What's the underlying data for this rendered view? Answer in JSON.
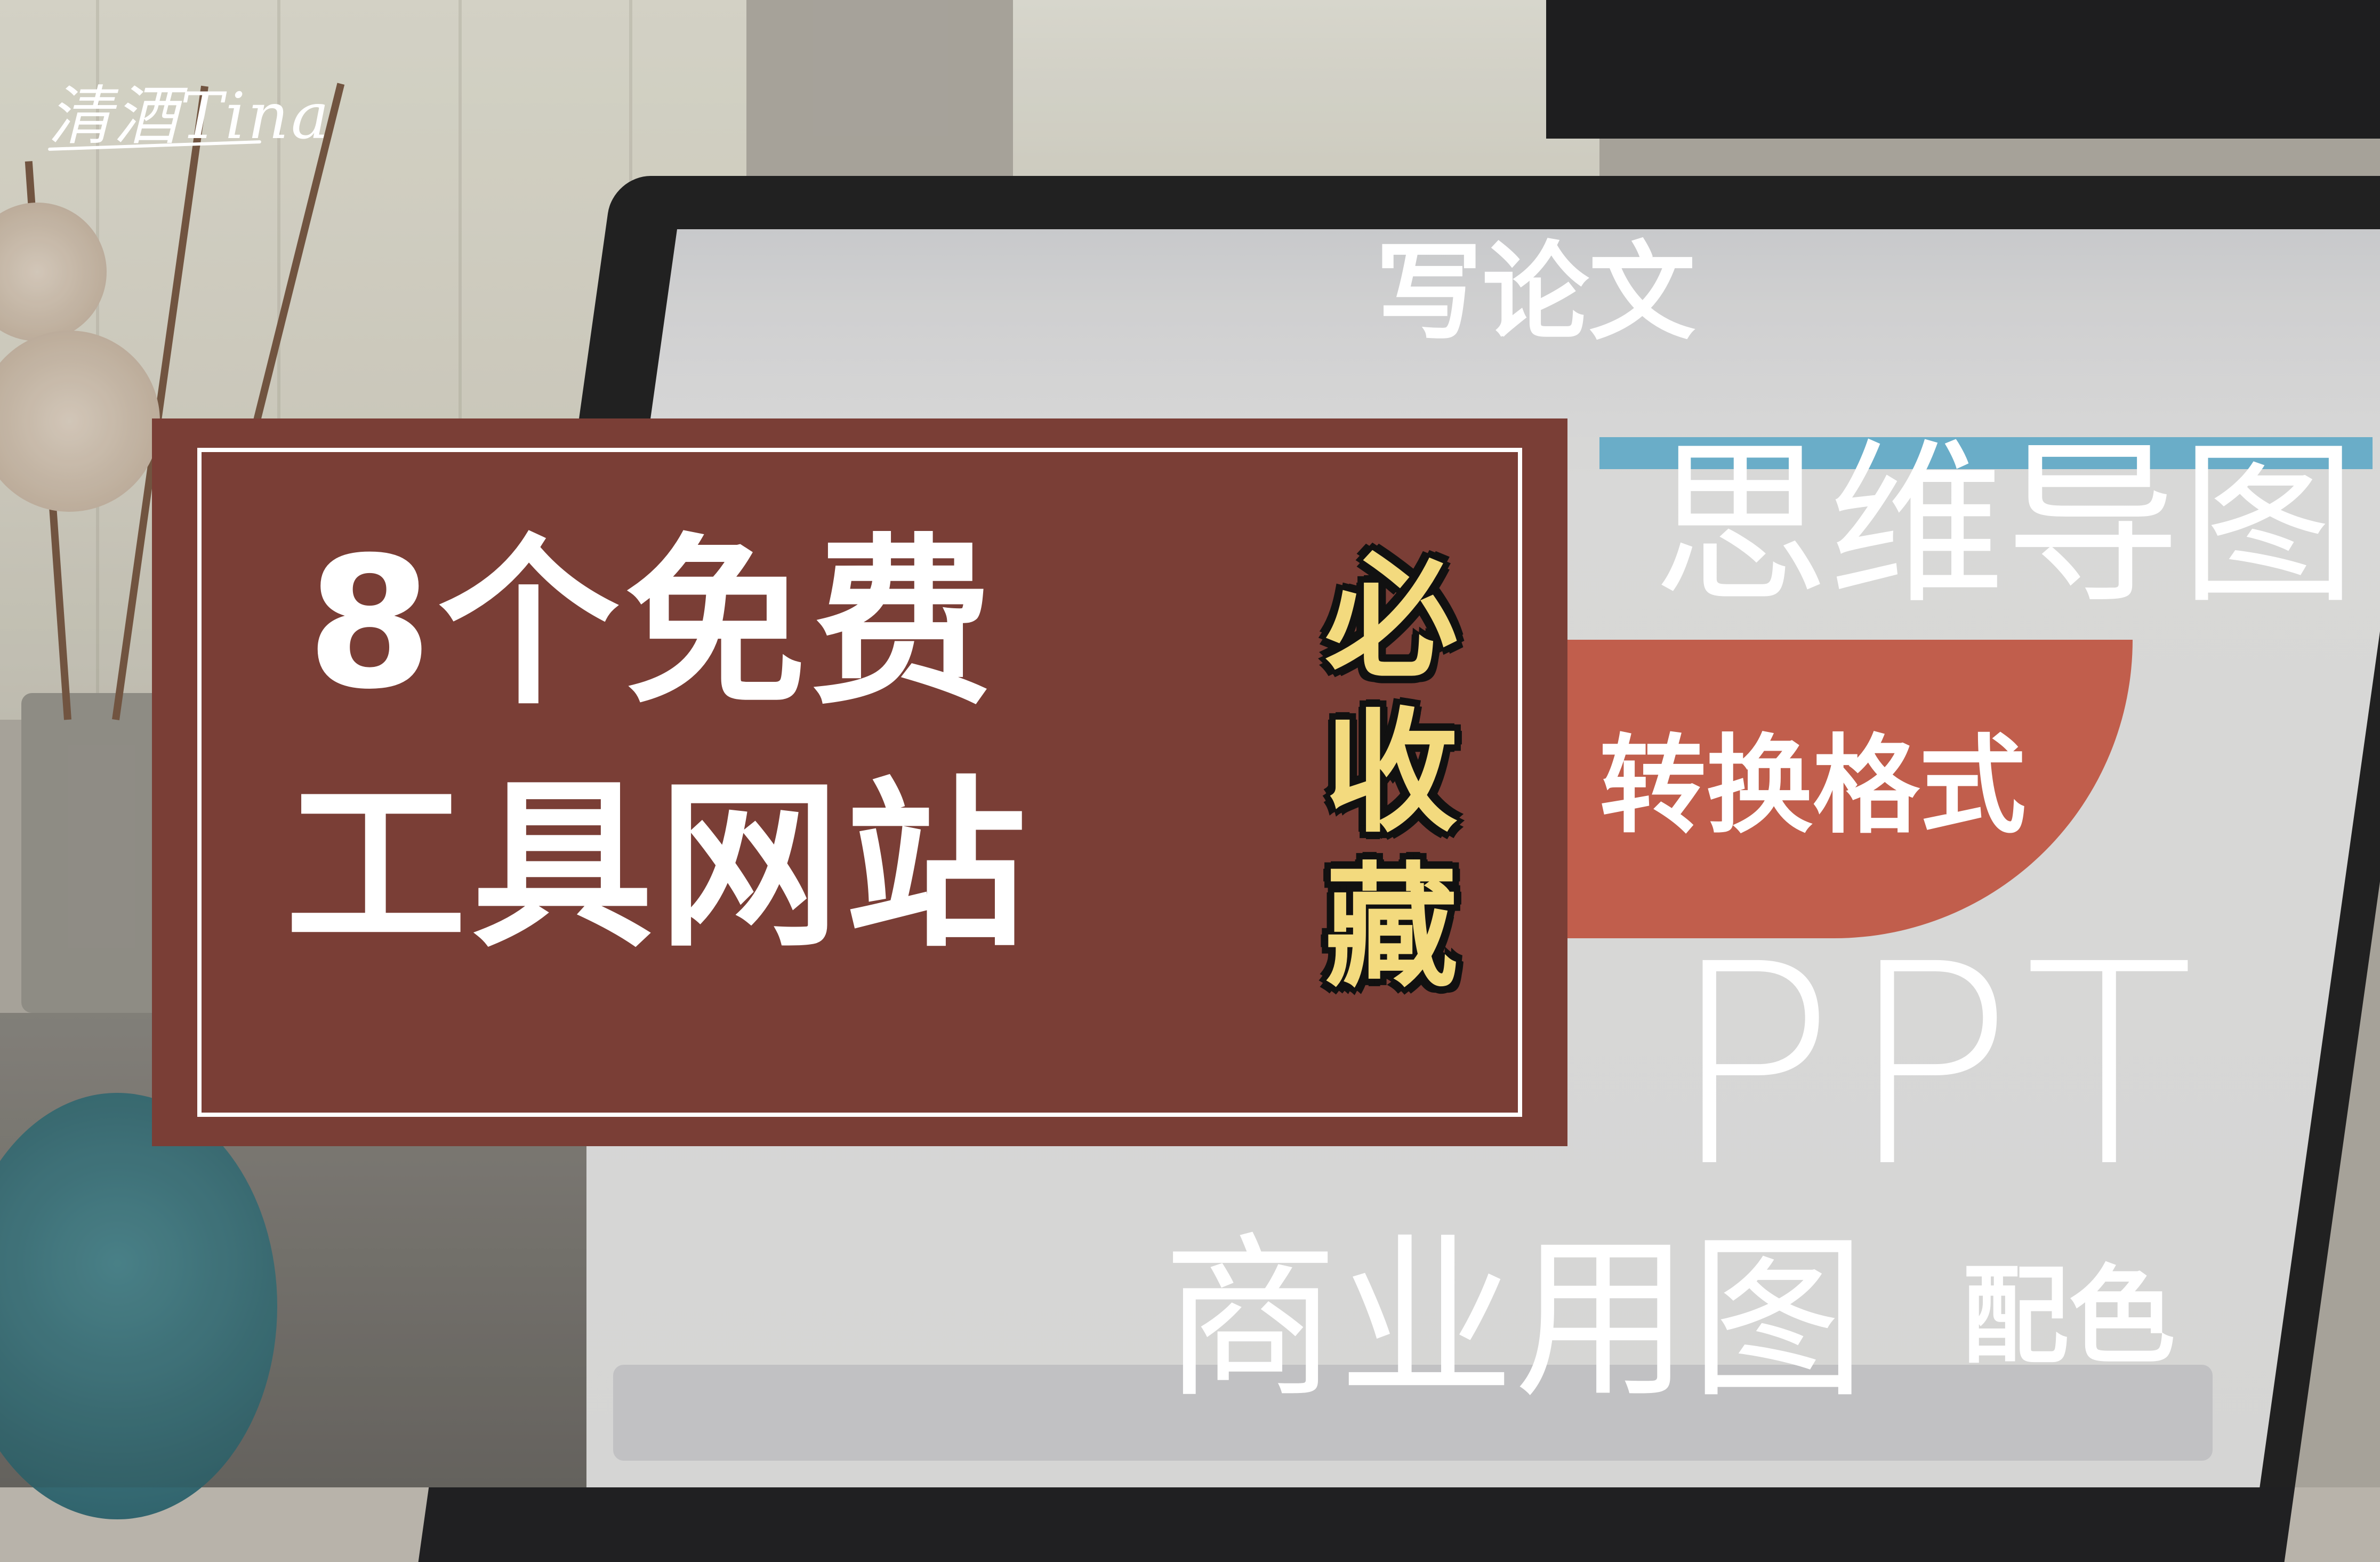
{
  "watermark": "清酒Tina",
  "title": {
    "line1": "8个免费",
    "line2": "工具网站",
    "badge": [
      "必",
      "收",
      "藏"
    ]
  },
  "labels": {
    "paper": "写论文",
    "mindmap": "思维导图",
    "convert": "转换格式",
    "ppt": "PPT",
    "business_images": "商业用图",
    "color": "配色"
  },
  "colors": {
    "card": "#7a3e36",
    "badge_fill": "#f3da7e",
    "badge_outline": "#111111",
    "text": "#ffffff"
  }
}
